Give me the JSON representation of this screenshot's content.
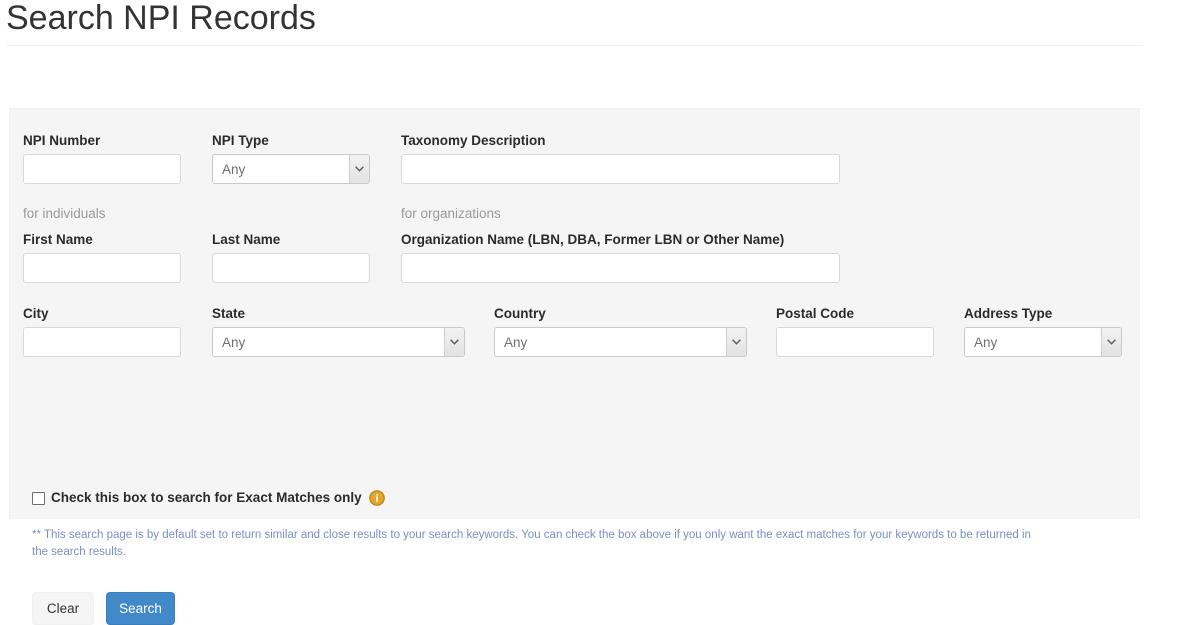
{
  "page": {
    "title": "Search NPI Records"
  },
  "form": {
    "npi_number": {
      "label": "NPI Number",
      "value": "",
      "placeholder": ""
    },
    "npi_type": {
      "label": "NPI Type",
      "value": "Any",
      "options": [
        "Any"
      ]
    },
    "taxonomy_description": {
      "label": "Taxonomy Description",
      "value": "",
      "placeholder": ""
    },
    "individuals_group_label": "for individuals",
    "organizations_group_label": "for organizations",
    "first_name": {
      "label": "First Name",
      "value": "",
      "placeholder": ""
    },
    "last_name": {
      "label": "Last Name",
      "value": "",
      "placeholder": ""
    },
    "organization_name": {
      "label": "Organization Name (LBN, DBA, Former LBN or Other Name)",
      "value": "",
      "placeholder": ""
    },
    "city": {
      "label": "City",
      "value": "",
      "placeholder": ""
    },
    "state": {
      "label": "State",
      "value": "Any",
      "options": [
        "Any"
      ]
    },
    "country": {
      "label": "Country",
      "value": "Any",
      "options": [
        "Any"
      ]
    },
    "postal_code": {
      "label": "Postal Code",
      "value": "",
      "placeholder": ""
    },
    "address_type": {
      "label": "Address Type",
      "value": "Any",
      "options": [
        "Any"
      ]
    },
    "exact_match": {
      "label": "Check this box to search for Exact Matches only",
      "checked": false,
      "info_icon": "info-circle-icon"
    },
    "note": "** This search page is by default set to return similar and close results to your search keywords. You can check the box above if you only want the exact matches for your keywords to be returned in the search results.",
    "buttons": {
      "clear": "Clear",
      "search": "Search"
    }
  },
  "colors": {
    "primary_button": "#4189c8",
    "panel_background": "#f5f5f5",
    "note_text": "#7b8fc0",
    "info_icon": "#e2a117"
  }
}
